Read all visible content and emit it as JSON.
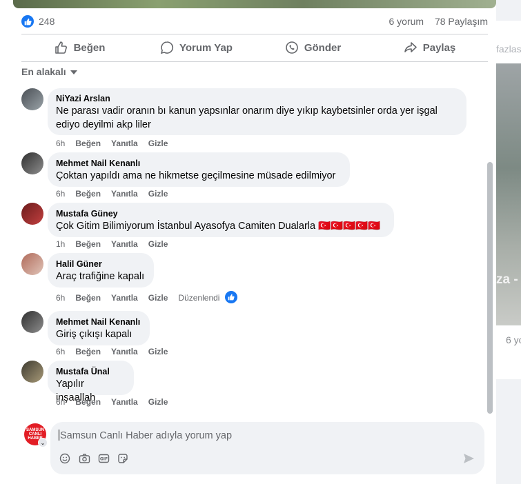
{
  "background": {
    "right_more_text": "fazlas",
    "right_count": "6 yo",
    "right_photo_text": "za -"
  },
  "post_stats": {
    "likes": "248",
    "comments": "6 yorum",
    "shares": "78 Paylaşım"
  },
  "actions": [
    {
      "label": "Beğen",
      "icon": "thumbs-up-icon"
    },
    {
      "label": "Yorum Yap",
      "icon": "comment-icon"
    },
    {
      "label": "Gönder",
      "icon": "whatsapp-icon"
    },
    {
      "label": "Paylaş",
      "icon": "share-icon"
    }
  ],
  "sort_label": "En alakalı",
  "comments": [
    {
      "author": "NiYazi Arslan",
      "lines": [
        "Ne parası vadir oranın bı kanun yapsınlar onarım diye yıkıp kaybetsinler orda yer işgal",
        "ediyo deyilmi akp liler"
      ],
      "time": "6h",
      "like": "Beğen",
      "reply": "Yanıtla",
      "hide": "Gizle"
    },
    {
      "author": "Mehmet Nail Kenanlı",
      "lines": [
        "Çoktan yapıldı ama ne hikmetse geçilmesine müsade edilmiyor"
      ],
      "time": "6h",
      "like": "Beğen",
      "reply": "Yanıtla",
      "hide": "Gizle"
    },
    {
      "author": "Mustafa Güney",
      "lines": [
        "Çok Gitim Bilimiyorum İstanbul Ayasofya Camiten Dualarla 🇹🇷🇹🇷🇹🇷🇹🇷🇹🇷"
      ],
      "time": "1h",
      "like": "Beğen",
      "reply": "Yanıtla",
      "hide": "Gizle"
    },
    {
      "author": "Halil Güner",
      "lines": [
        "Araç trafiğine kapalı"
      ],
      "time": "6h",
      "like": "Beğen",
      "reply": "Yanıtla",
      "hide": "Gizle",
      "edited": "Düzenlendi"
    },
    {
      "author": "Mehmet Nail Kenanlı",
      "lines": [
        "Giriş çıkışı kapalı"
      ],
      "time": "6h",
      "like": "Beğen",
      "reply": "Yanıtla",
      "hide": "Gizle"
    },
    {
      "author": "Mustafa Ünal",
      "lines": [
        "Yapılır inşaallah"
      ],
      "time": "6h",
      "like": "Beğen",
      "reply": "Yanıtla",
      "hide": "Gizle"
    }
  ],
  "composer": {
    "placeholder": "Samsun Canlı Haber adıyla yorum yap",
    "avatar_text": "SAMSUN CANLI HABER"
  },
  "colors": {
    "accent": "#1877f2",
    "brand_red": "#e21d25"
  }
}
